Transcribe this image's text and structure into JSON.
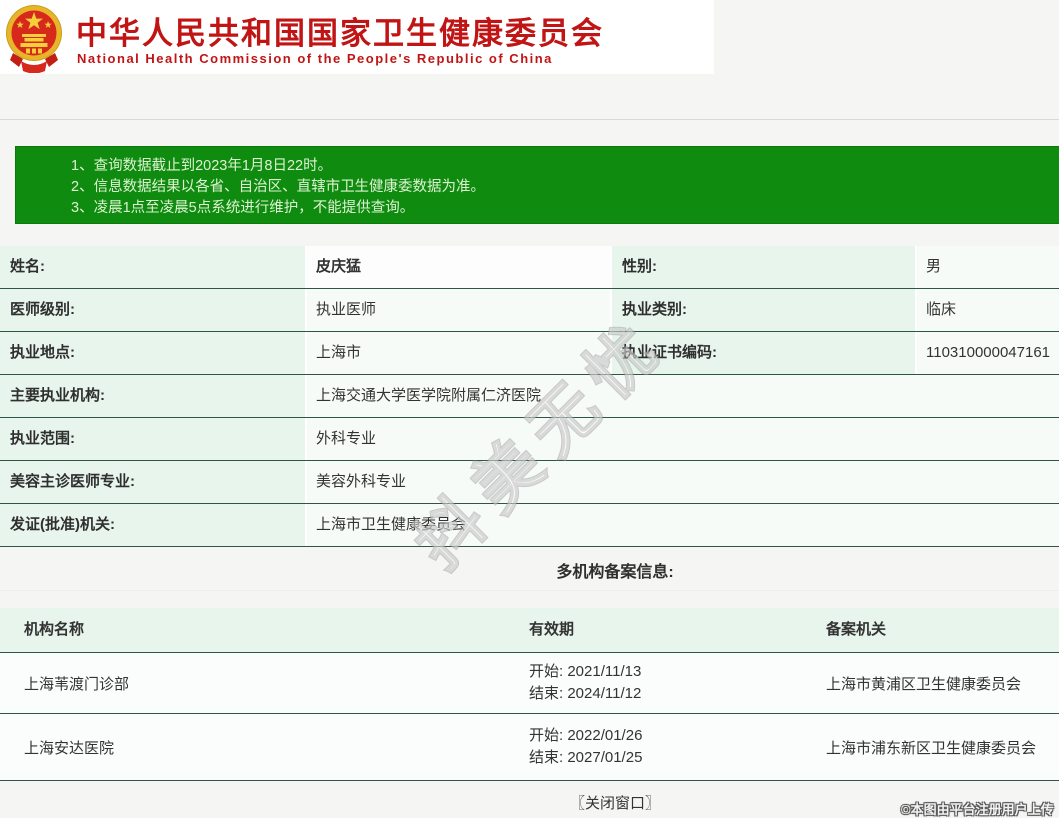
{
  "header": {
    "emblem_icon": "china-national-emblem",
    "title_cn": "中华人民共和国国家卫生健康委员会",
    "title_en": "National Health Commission of the People's Republic of China"
  },
  "notice": {
    "lines": [
      "1、查询数据截止到2023年1月8日22时。",
      "2、信息数据结果以各省、自治区、直辖市卫生健康委数据为准。",
      "3、凌晨1点至凌晨5点系统进行维护，不能提供查询。"
    ]
  },
  "doctor_info": {
    "rows": [
      {
        "label": "姓名:",
        "value": "皮庆猛",
        "label2": "性别:",
        "value2": "男"
      },
      {
        "label": "医师级别:",
        "value": "执业医师",
        "label2": "执业类别:",
        "value2": "临床"
      },
      {
        "label": "执业地点:",
        "value": "上海市",
        "label2": "执业证书编码:",
        "value2": "110310000047161"
      },
      {
        "label": "主要执业机构:",
        "value": "上海交通大学医学院附属仁济医院"
      },
      {
        "label": "执业范围:",
        "value": "外科专业"
      },
      {
        "label": "美容主诊医师专业:",
        "value": "美容外科专业"
      },
      {
        "label": "发证(批准)机关:",
        "value": "上海市卫生健康委员会"
      }
    ]
  },
  "filing": {
    "section_title": "多机构备案信息:",
    "headers": {
      "institution": "机构名称",
      "validity": "有效期",
      "authority": "备案机关"
    },
    "rows": [
      {
        "institution": "上海苇渡门诊部",
        "validity_start": "开始: 2021/11/13",
        "validity_end": "结束: 2024/11/12",
        "authority": "上海市黄浦区卫生健康委员会"
      },
      {
        "institution": "上海安达医院",
        "validity_start": "开始: 2022/01/26",
        "validity_end": "结束: 2027/01/25",
        "authority": "上海市浦东新区卫生健康委员会"
      }
    ]
  },
  "footer": {
    "close_label": "〖关闭窗口〗"
  },
  "watermarks": {
    "diagonal": "抖美无忧",
    "bottom_right": "©本图由平台注册用户上传"
  },
  "colors": {
    "accent_red": "#c11414",
    "notice_green": "#0f8c0f",
    "row_divider_green": "#2e5547",
    "label_cell_mint": "#e7f5ec",
    "value_cell": "#f7fbf8",
    "page_background": "#f5f5f4"
  }
}
